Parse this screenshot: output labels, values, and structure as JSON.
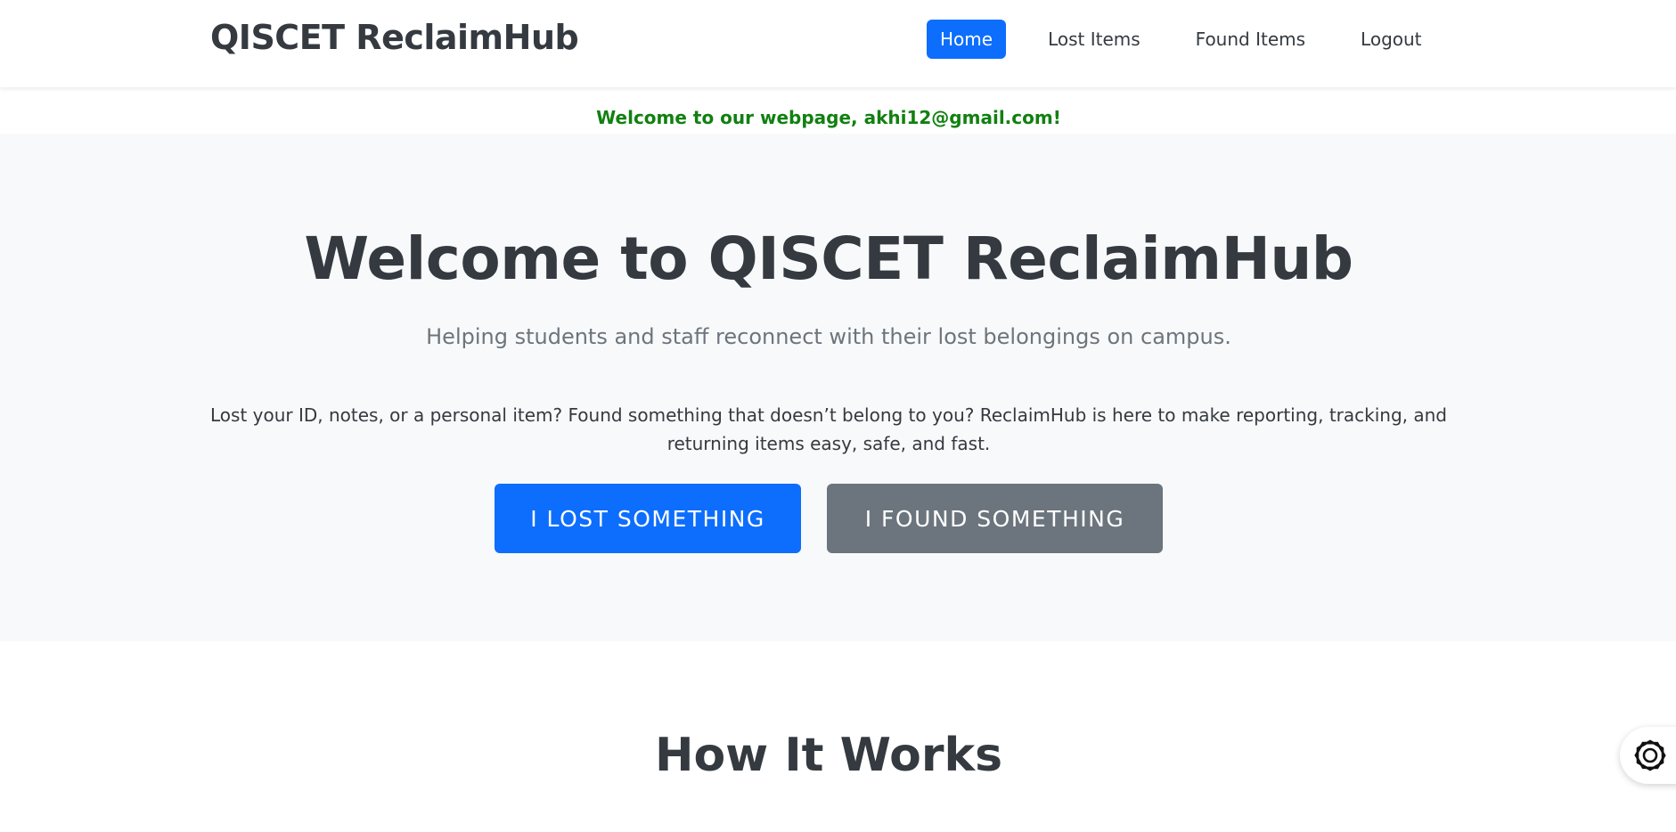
{
  "navbar": {
    "brand": "QISCET ReclaimHub",
    "links": [
      {
        "label": "Home",
        "active": true
      },
      {
        "label": "Lost Items",
        "active": false
      },
      {
        "label": "Found Items",
        "active": false
      },
      {
        "label": "Logout",
        "active": false
      }
    ]
  },
  "welcome_message": "Welcome to our webpage, akhi12@gmail.com!",
  "hero": {
    "title": "Welcome to QISCET ReclaimHub",
    "subtitle": "Helping students and staff reconnect with their lost belongings on campus.",
    "description": "Lost your ID, notes, or a personal item? Found something that doesn’t belong to you? ReclaimHub is here to make reporting, tracking, and returning items easy, safe, and fast.",
    "primary_button": "I LOST SOMETHING",
    "secondary_button": "I FOUND SOMETHING"
  },
  "section": {
    "title": "How It Works"
  },
  "widget": {
    "icon": "chat-assistant-icon"
  },
  "colors": {
    "primary": "#0d6efd",
    "secondary": "#6c757d",
    "success_text": "#118011",
    "dark_text": "#343a40",
    "hero_bg": "#f8f9fa"
  }
}
